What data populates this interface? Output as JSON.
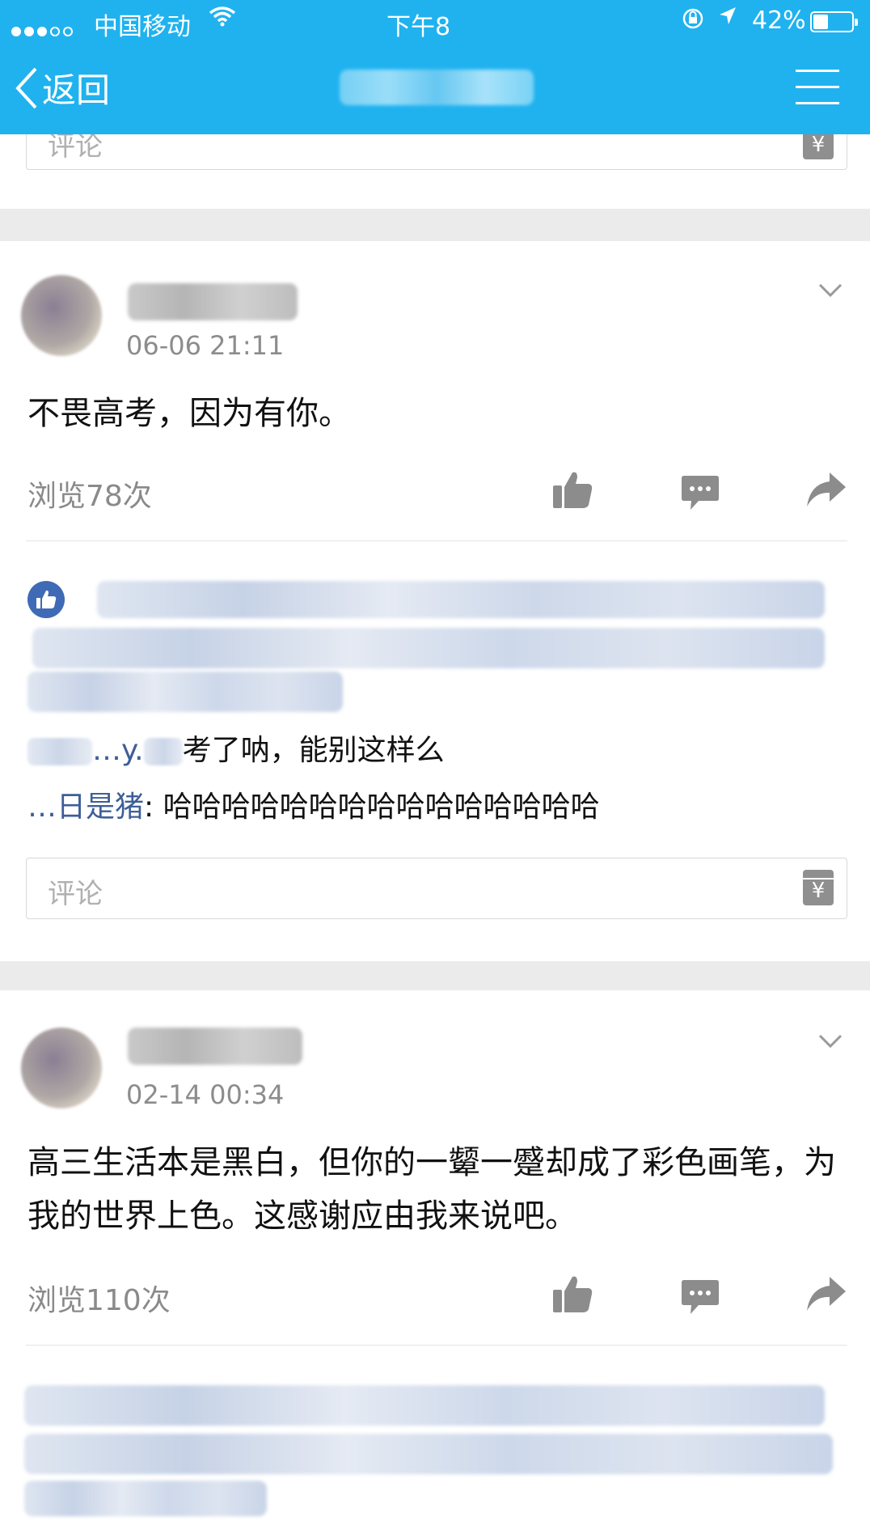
{
  "status_bar": {
    "carrier": "中国移动",
    "time": "下午8",
    "battery_percent": "42%",
    "battery_level": 0.42
  },
  "nav": {
    "back_label": "返回",
    "title": ""
  },
  "top_comment": {
    "placeholder": "评论"
  },
  "posts": [
    {
      "author": "",
      "timestamp": "06-06 21:11",
      "text": "不畏高考，因为有你。",
      "views": "浏览78次",
      "replies": [
        {
          "author": "…y.",
          "text": "考了呐，能别这样么"
        },
        {
          "author": "…日是猪",
          "text": ": 哈哈哈哈哈哈哈哈哈哈哈哈哈哈哈"
        }
      ],
      "comment_placeholder": "评论"
    },
    {
      "author": "",
      "timestamp": "02-14 00:34",
      "text": "高三生活本是黑白，但你的一颦一蹙却成了彩色画笔，为我的世界上色。这感谢应由我来说吧。",
      "views": "浏览110次"
    }
  ],
  "colors": {
    "nav_bar": "#1fb2ef",
    "link": "#3e5e98",
    "like_badge": "#3f6ab5",
    "icon_gray": "#8c8c8c"
  },
  "icons": [
    "chevron-left-icon",
    "menu-icon",
    "gift-icon",
    "chevron-down-icon",
    "thumbs-up-icon",
    "comment-icon",
    "share-icon"
  ]
}
